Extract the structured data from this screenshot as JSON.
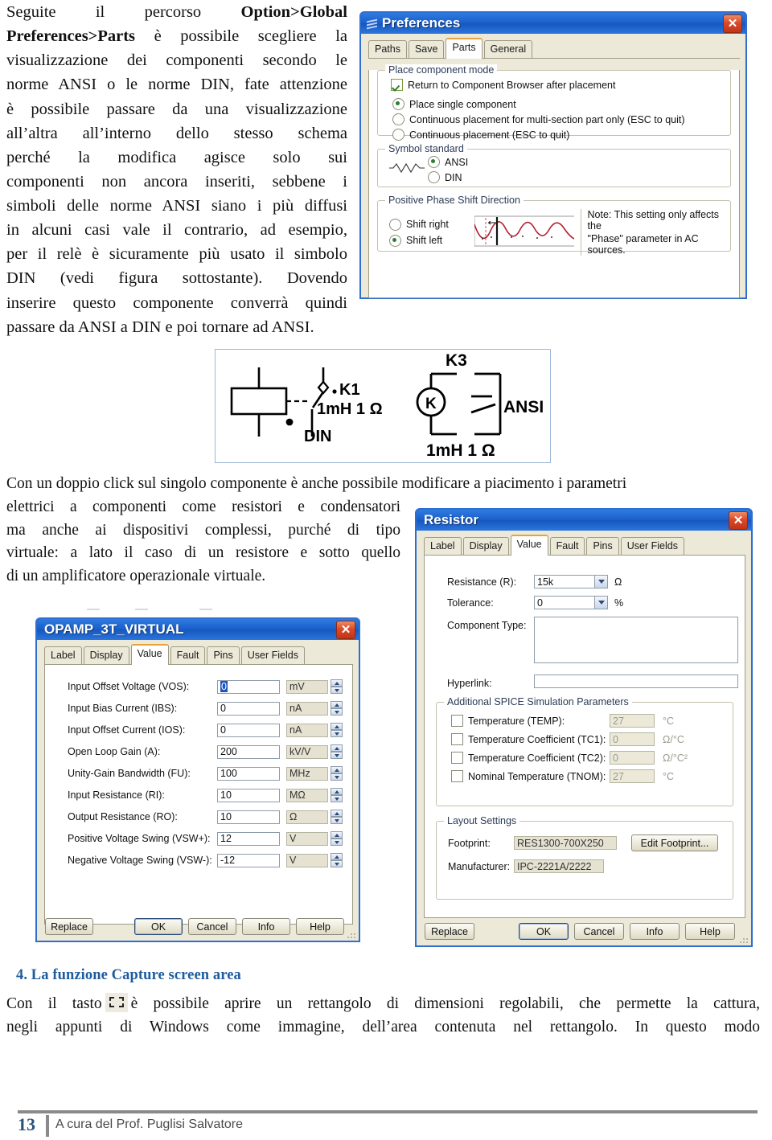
{
  "document": {
    "paragraph_top": {
      "bold_prefix": "Option>Global Preferences>Parts",
      "lines": [
        "Seguite il percorso ",
        "è possibile scegliere la",
        "visualizzazione dei componenti secondo le",
        "norme ANSI o le norme DIN, fate attenzione",
        "è possibile passare da una visualizzazione",
        "all’altra all’interno dello stesso schema",
        "perché la modifica agisce solo sui",
        "componenti non ancora  inseriti, sebbene i",
        "simboli delle norme ANSI siano i più diffusi",
        "in alcuni casi vale il contrario, ad esempio,",
        "per il relè è sicuramente più usato il simbolo",
        "DIN (vedi figura sottostante). Dovendo",
        "inserire questo componente converrà quindi",
        "passare da ANSI a DIN e poi tornare ad ANSI."
      ]
    },
    "paragraph_middle_full": "Con un doppio click sul singolo componente è anche possibile modificare  a piacimento i parametri",
    "paragraph_middle_left": [
      "elettrici a componenti come resistori e condensatori",
      "ma anche ai dispositivi complessi, purché di tipo",
      "virtuale: a lato il caso di un resistore e sotto quello",
      "di un amplificatore operazionale virtuale."
    ],
    "heading": "4. La funzione Capture screen area",
    "heading_color": "#1F5C9E",
    "paragraph_bottom": {
      "before_icon": "Con il tasto",
      "icon": "capture-screen-area-icon",
      "after_icon": "è possibile aprire un rettangolo di dimensioni regolabili, che permette la cattura,",
      "line2": "negli appunti di Windows come immagine, dell’area contenuta nel rettangolo. In questo modo"
    },
    "footer": {
      "page_number": "13",
      "text": "A cura del Prof. Puglisi Salvatore"
    }
  },
  "preferences_dialog": {
    "title": "Preferences",
    "close_label": "✕",
    "tabs": [
      {
        "label": "Paths",
        "active": false
      },
      {
        "label": "Save",
        "active": false
      },
      {
        "label": "Parts",
        "active": true
      },
      {
        "label": "General",
        "active": false
      }
    ],
    "place_component_mode": {
      "legend": "Place component mode",
      "checkbox": {
        "label": "Return to Component Browser after placement",
        "checked": true
      },
      "radios": [
        {
          "label": "Place single component",
          "selected": true
        },
        {
          "label": "Continuous placement for multi-section part only (ESC to quit)",
          "selected": false
        },
        {
          "label": "Continuous placement (ESC to quit)",
          "selected": false
        }
      ]
    },
    "symbol_standard": {
      "legend": "Symbol standard",
      "radios": [
        {
          "label": "ANSI",
          "selected": true
        },
        {
          "label": "DIN",
          "selected": false
        }
      ]
    },
    "phase_shift": {
      "legend": "Positive Phase Shift Direction",
      "radios": [
        {
          "label": "Shift right",
          "selected": false
        },
        {
          "label": "Shift left",
          "selected": true
        }
      ],
      "note_line1": "Note: This setting only affects the",
      "note_line2": "\"Phase\" parameter in AC sources.",
      "waveform_color": "#B32030"
    }
  },
  "relay_figure": {
    "din": {
      "label_ref": "K1",
      "label_value": "1mH 1 Ω",
      "standard": "DIN"
    },
    "ansi": {
      "label_ref": "K3",
      "coil_letter": "K",
      "label_value": "1mH 1 Ω",
      "standard": "ANSI"
    }
  },
  "resistor_dialog": {
    "title": "Resistor",
    "close_label": "✕",
    "tabs": [
      {
        "label": "Label",
        "active": false
      },
      {
        "label": "Display",
        "active": false
      },
      {
        "label": "Value",
        "active": true
      },
      {
        "label": "Fault",
        "active": false
      },
      {
        "label": "Pins",
        "active": false
      },
      {
        "label": "User Fields",
        "active": false
      }
    ],
    "fields": [
      {
        "label": "Resistance (R):",
        "value": "15k",
        "unit": "Ω"
      },
      {
        "label": "Tolerance:",
        "value": "0",
        "unit": "%"
      }
    ],
    "component_type_label": "Component Type:",
    "component_type_value": "",
    "hyperlink_label": "Hyperlink:",
    "hyperlink_value": "",
    "spice": {
      "legend": "Additional SPICE Simulation Parameters",
      "rows": [
        {
          "label": "Temperature (TEMP):",
          "value": "27",
          "unit": "°C",
          "checked": false
        },
        {
          "label": "Temperature Coefficient (TC1):",
          "value": "0",
          "unit": "Ω/°C",
          "checked": false
        },
        {
          "label": "Temperature Coefficient (TC2):",
          "value": "0",
          "unit": "Ω/°C²",
          "checked": false
        },
        {
          "label": "Nominal Temperature (TNOM):",
          "value": "27",
          "unit": "°C",
          "checked": false
        }
      ]
    },
    "layout": {
      "legend": "Layout Settings",
      "footprint_label": "Footprint:",
      "footprint_value": "RES1300-700X250",
      "manufacturer_label": "Manufacturer:",
      "manufacturer_value": "IPC-2221A/2222",
      "edit_footprint_button": "Edit Footprint..."
    },
    "buttons": {
      "replace": "Replace",
      "ok": "OK",
      "cancel": "Cancel",
      "info": "Info",
      "help": "Help"
    }
  },
  "opamp_dialog": {
    "title": "OPAMP_3T_VIRTUAL",
    "close_label": "✕",
    "tabs": [
      {
        "label": "Label",
        "active": false
      },
      {
        "label": "Display",
        "active": false
      },
      {
        "label": "Value",
        "active": true
      },
      {
        "label": "Fault",
        "active": false
      },
      {
        "label": "Pins",
        "active": false
      },
      {
        "label": "User Fields",
        "active": false
      }
    ],
    "rows": [
      {
        "label": "Input Offset Voltage (VOS):",
        "value": "0",
        "unit": "mV",
        "selected": true
      },
      {
        "label": "Input Bias Current (IBS):",
        "value": "0",
        "unit": "nA",
        "selected": false
      },
      {
        "label": "Input Offset Current (IOS):",
        "value": "0",
        "unit": "nA",
        "selected": false
      },
      {
        "label": "Open Loop Gain (A):",
        "value": "200",
        "unit": "kV/V",
        "selected": false
      },
      {
        "label": "Unity-Gain Bandwidth (FU):",
        "value": "100",
        "unit": "MHz",
        "selected": false
      },
      {
        "label": "Input Resistance (RI):",
        "value": "10",
        "unit": "MΩ",
        "selected": false
      },
      {
        "label": "Output Resistance (RO):",
        "value": "10",
        "unit": "Ω",
        "selected": false
      },
      {
        "label": "Positive Voltage Swing (VSW+):",
        "value": "12",
        "unit": "V",
        "selected": false
      },
      {
        "label": "Negative Voltage Swing (VSW-):",
        "value": "-12",
        "unit": "V",
        "selected": false
      }
    ],
    "buttons": {
      "replace": "Replace",
      "ok": "OK",
      "cancel": "Cancel",
      "info": "Info",
      "help": "Help"
    }
  }
}
